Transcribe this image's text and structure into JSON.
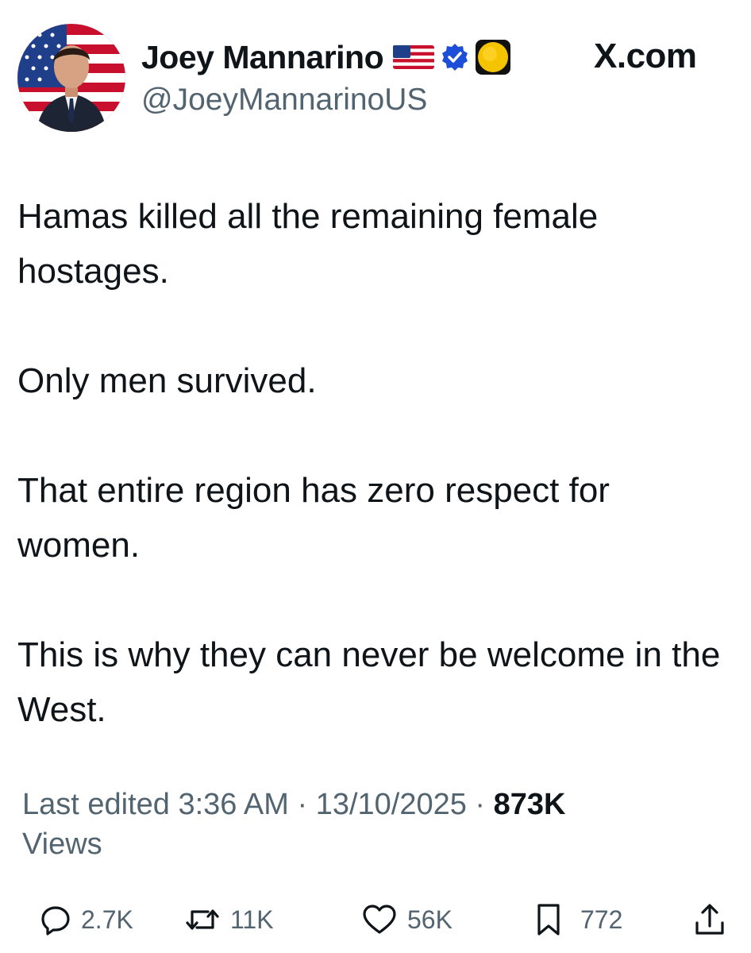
{
  "author": {
    "display_name": "Joey Mannarino",
    "handle": "@JoeyMannarinoUS",
    "badges": [
      "us-flag-emoji",
      "verified-check",
      "gold-circle-emoji"
    ],
    "avatar": "avatar-photo"
  },
  "site_label": "X.com",
  "tweet": {
    "paragraphs": [
      "Hamas killed all the remaining female hostages.",
      "Only men survived.",
      "That entire region has zero respect for women.",
      "This is why they can never be welcome in the West."
    ]
  },
  "meta": {
    "edited_prefix": "Last edited 3:36 AM",
    "date": "13/10/2025",
    "views_count": "873K",
    "views_label": "Views"
  },
  "actions": {
    "replies": "2.7K",
    "reposts": "11K",
    "likes": "56K",
    "bookmarks": "772",
    "share_icon": "share-icon"
  },
  "colors": {
    "text": "#0f1419",
    "secondary": "#536471",
    "verified_blue": "#1d4ed8",
    "gold_badge": "#f5c400"
  }
}
